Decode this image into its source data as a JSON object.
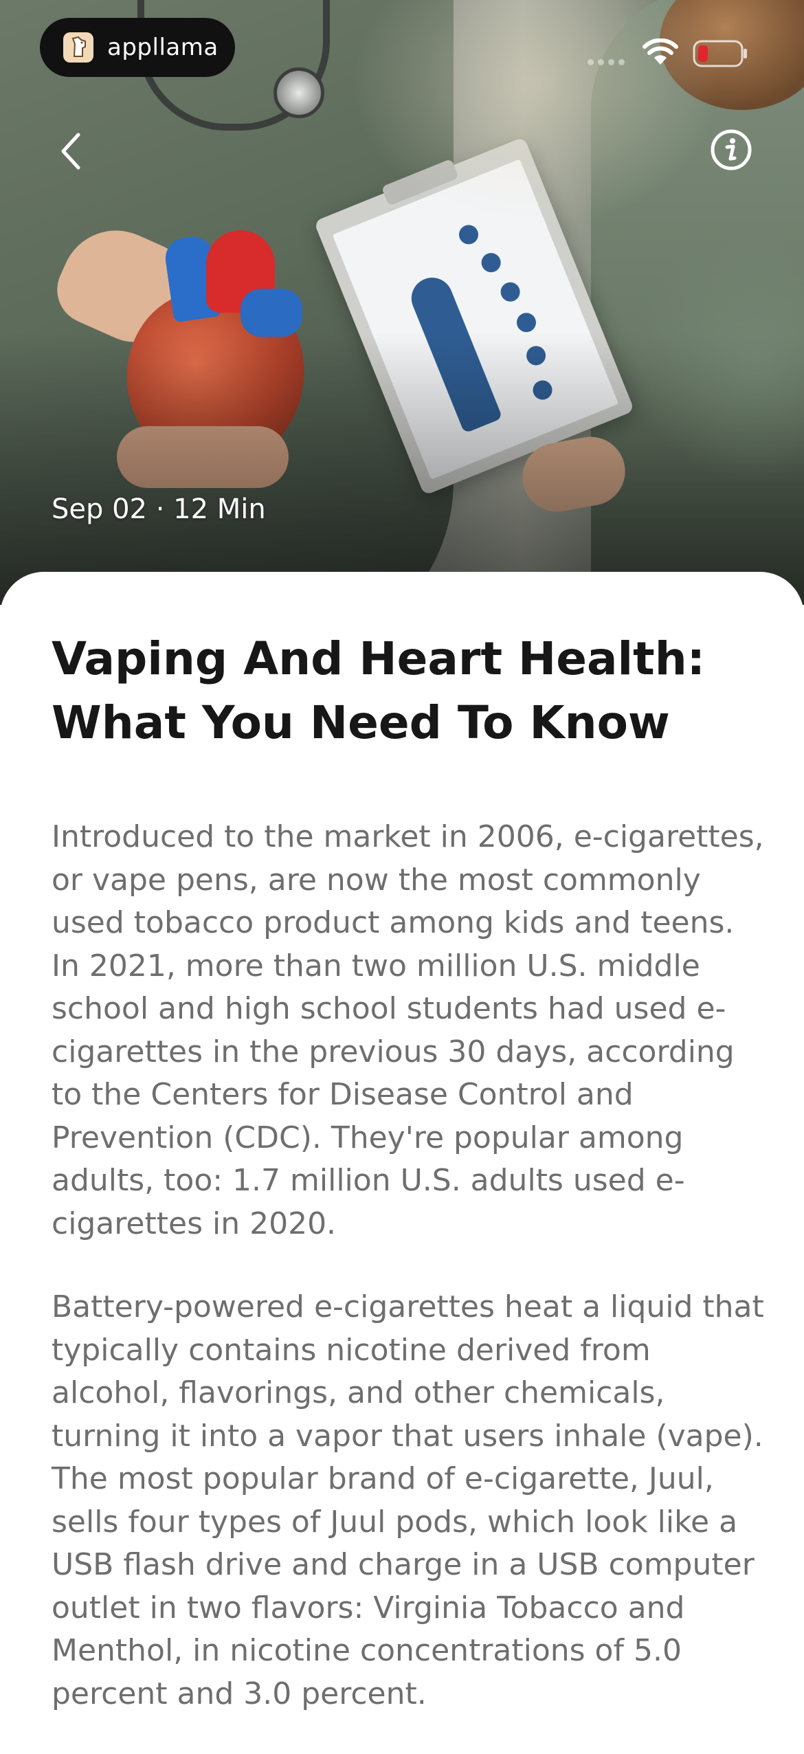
{
  "status_bar": {
    "app_name": "appllama"
  },
  "hero": {
    "date": "Sep 02",
    "separator": "·",
    "read_time": "12 Min"
  },
  "article": {
    "title": "Vaping And Heart Health: What You Need To Know",
    "paragraphs": [
      "Introduced to the market in 2006, e-cigarettes, or vape pens, are now the most commonly used tobacco product among kids and teens. In 2021, more than two million U.S. middle school and high school students had used e-cigarettes in the previous 30 days, according to the Centers for Disease Control and Prevention (CDC). They're popular among adults, too: 1.7 million U.S. adults used e-cigarettes in 2020.",
      "Battery-powered e-cigarettes heat a liquid that typically contains nicotine derived from alcohol, flavorings, and other chemicals, turning it into a vapor that users inhale (vape). The most popular brand of e-cigarette, Juul, sells four types of Juul pods, which look like a USB flash drive and charge in a USB computer outlet in two flavors: Virginia Tobacco and Menthol, in nicotine concentrations of 5.0 percent and 3.0 percent."
    ]
  },
  "icons": {
    "back": "chevron-left-icon",
    "info": "info-icon",
    "wifi": "wifi-icon",
    "battery": "battery-icon",
    "logo": "llama-logo-icon"
  },
  "colors": {
    "battery_level": "#e0262b",
    "title_text": "#171717",
    "body_text": "#6e6e6e"
  }
}
